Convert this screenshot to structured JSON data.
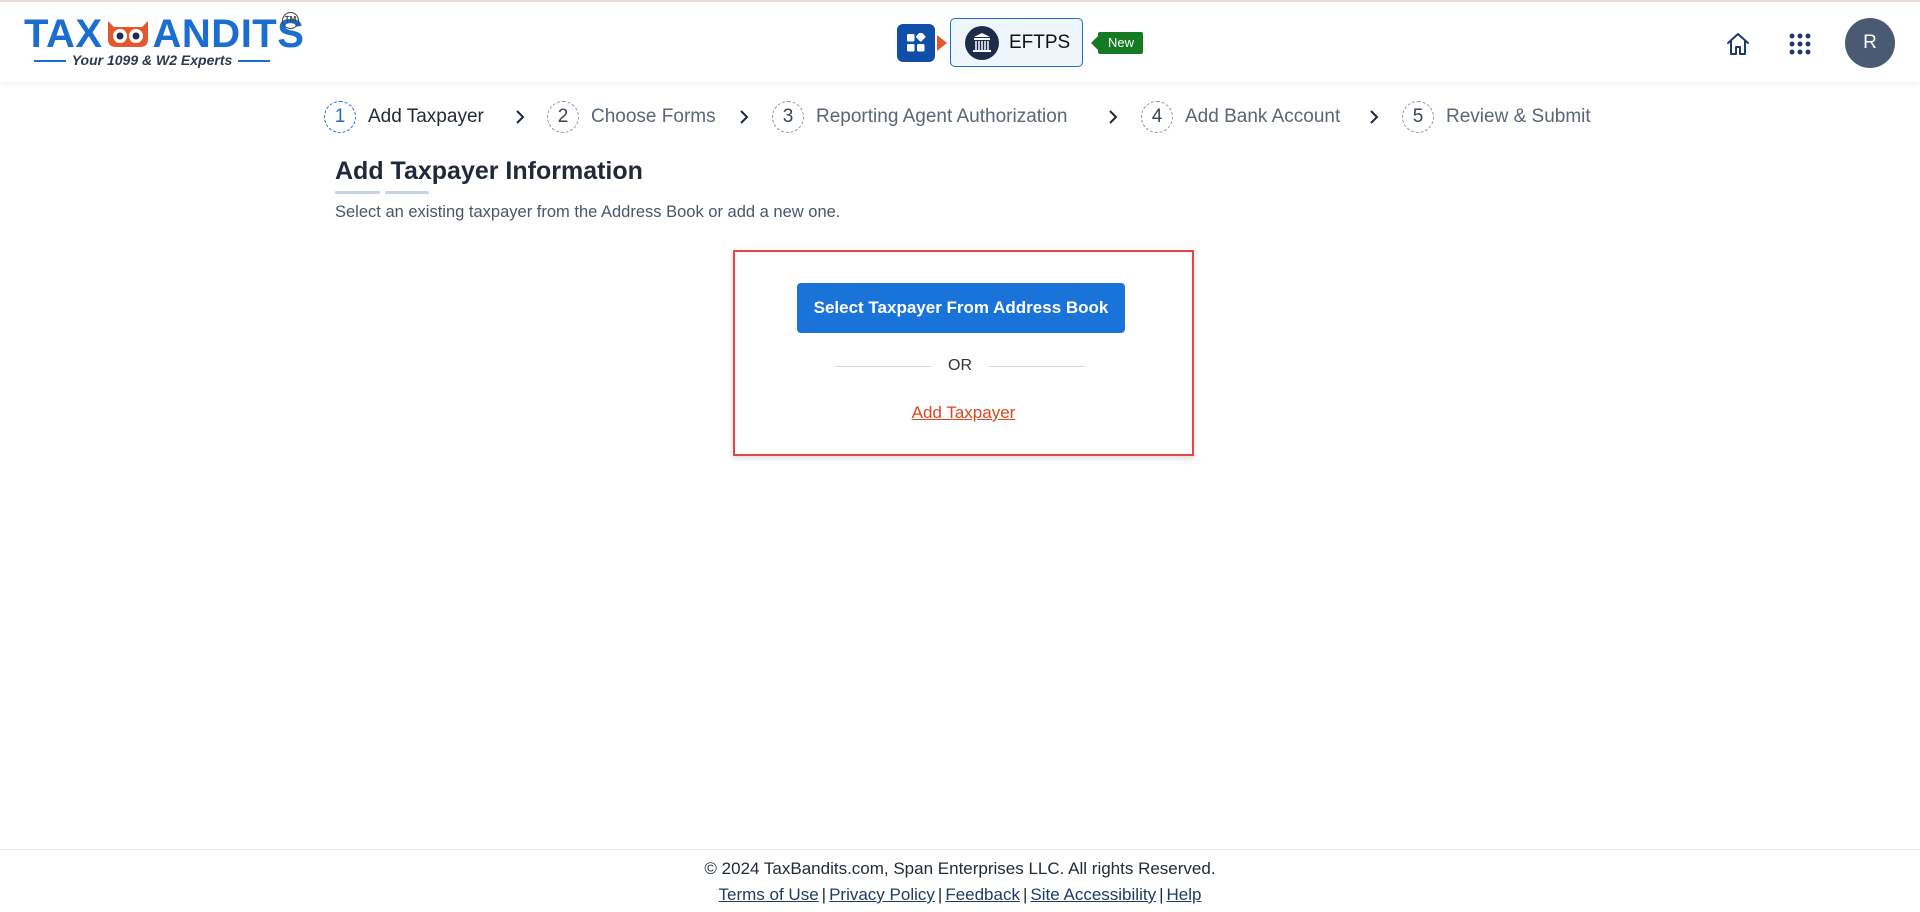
{
  "header": {
    "logo_text_left": "TAX",
    "logo_text_right": "ANDITS",
    "logo_tagline": "Your 1099 & W2 Experts",
    "logo_trademark": "TM",
    "eftps_label": "EFTPS",
    "new_badge": "New",
    "avatar_initial": "R",
    "icons": [
      "apps-switch-icon",
      "home-icon",
      "grid-menu-icon"
    ],
    "accent_color": "#1c6dd0"
  },
  "stepper": {
    "steps": [
      {
        "num": "1",
        "label": "Add Taxpayer",
        "active": true
      },
      {
        "num": "2",
        "label": "Choose Forms",
        "active": false
      },
      {
        "num": "3",
        "label": "Reporting Agent Authorization",
        "active": false
      },
      {
        "num": "4",
        "label": "Add Bank Account",
        "active": false
      },
      {
        "num": "5",
        "label": "Review & Submit",
        "active": false
      }
    ]
  },
  "main": {
    "title": "Add Taxpayer Information",
    "subtitle": "Select an existing taxpayer from the Address Book or add a new one.",
    "select_button": "Select Taxpayer From Address Book",
    "or_text": "OR",
    "add_link": "Add Taxpayer",
    "primary_color": "#1a73d8",
    "link_color": "#d9481e",
    "highlight_border_color": "#e04848"
  },
  "footer": {
    "copyright": "© 2024 TaxBandits.com, Span Enterprises LLC. All rights Reserved.",
    "links": [
      "Terms of Use",
      "Privacy Policy",
      "Feedback",
      "Site Accessibility",
      "Help"
    ]
  }
}
